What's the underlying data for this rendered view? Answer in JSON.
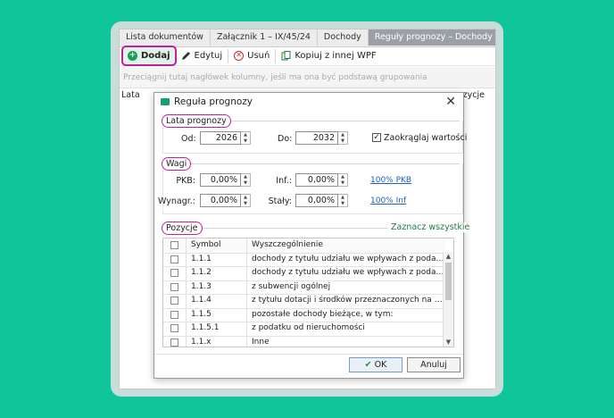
{
  "tabs": [
    {
      "label": "Lista dokumentów"
    },
    {
      "label": "Załącznik 1 – IX/45/24"
    },
    {
      "label": "Dochody"
    },
    {
      "label": "Reguły prognozy – Dochody"
    }
  ],
  "toolbar": {
    "add": "Dodaj",
    "edit": "Edytuj",
    "delete": "Usuń",
    "copy": "Kopiuj z innej WPF"
  },
  "groupbar_text": "Przeciągnij tutaj nagłówek kolumny, jeśli ma ona być podstawą grupowania",
  "background_columns": {
    "left": "Lata",
    "right": "ozycje"
  },
  "dialog": {
    "title": "Reguła prognozy",
    "years": {
      "section": "Lata prognozy",
      "from_label": "Od:",
      "from_value": "2026",
      "to_label": "Do:",
      "to_value": "2032",
      "round_label": "Zaokrąglaj wartości",
      "round_checked": true
    },
    "weights": {
      "section": "Wagi",
      "pkb_label": "PKB:",
      "pkb_value": "0,00%",
      "inf_label": "Inf.:",
      "inf_value": "0,00%",
      "wage_label": "Wynagr.:",
      "wage_value": "0,00%",
      "const_label": "Stały:",
      "const_value": "0,00%",
      "link_pkb": "100% PKB",
      "link_inf": "100% Inf"
    },
    "positions": {
      "section": "Pozycje",
      "select_all": "Zaznacz wszystkie",
      "col_symbol": "Symbol",
      "col_desc": "Wyszczególnienie",
      "rows": [
        {
          "symbol": "1.1.1",
          "desc": "dochody z tytułu udziału we wpływach z podatku doc..."
        },
        {
          "symbol": "1.1.2",
          "desc": "dochody z tytułu udziału we wpływach z podatku doc..."
        },
        {
          "symbol": "1.1.3",
          "desc": "z subwencji ogólnej"
        },
        {
          "symbol": "1.1.4",
          "desc": "z tytułu dotacji i środków przeznaczonych na cele bie..."
        },
        {
          "symbol": "1.1.5",
          "desc": "pozostałe dochody bieżące, w tym:"
        },
        {
          "symbol": "1.1.5.1",
          "desc": "z podatku od nieruchomości"
        },
        {
          "symbol": "1.1.x",
          "desc": "Inne"
        }
      ]
    },
    "ok": "OK",
    "cancel": "Anuluj"
  },
  "colors": {
    "background": "#0fc59a",
    "highlight": "#c21fa0",
    "link": "#1e5fbf"
  }
}
